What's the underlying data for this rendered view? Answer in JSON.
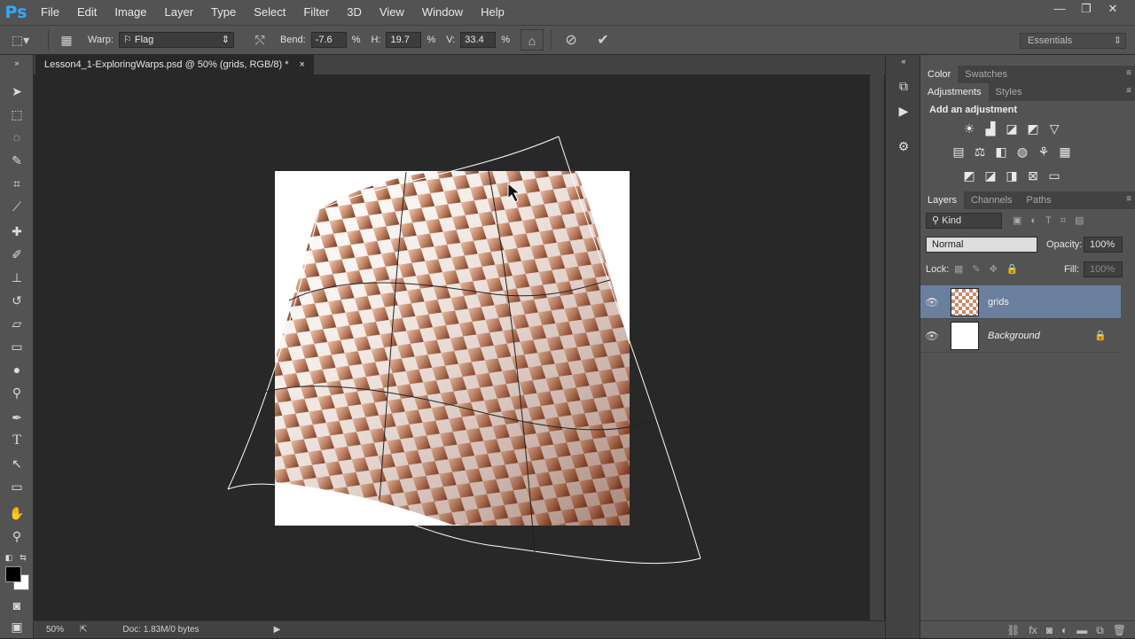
{
  "app": {
    "logo": "Ps",
    "menu": [
      "File",
      "Edit",
      "Image",
      "Layer",
      "Type",
      "Select",
      "Filter",
      "3D",
      "View",
      "Window",
      "Help"
    ],
    "window_controls": [
      "—",
      "❐",
      "✕"
    ]
  },
  "options": {
    "warp_label": "Warp:",
    "warp_style": "Flag",
    "bend_label": "Bend:",
    "bend_value": "-7.6",
    "h_label": "H:",
    "h_value": "19.7",
    "v_label": "V:",
    "v_value": "33.4",
    "percent": "%",
    "workspace": "Essentials"
  },
  "document": {
    "tab_title": "Lesson4_1-ExploringWarps.psd @ 50% (grids, RGB/8) *",
    "close": "×",
    "checker_colors": [
      "#f2c6ad",
      "#6e2a10"
    ]
  },
  "status": {
    "zoom": "50%",
    "doc": "Doc: 1.83M/0 bytes"
  },
  "panels": {
    "color_tabs": [
      "Color",
      "Swatches"
    ],
    "adjust_tabs": [
      "Adjustments",
      "Styles"
    ],
    "adjust_title": "Add an adjustment",
    "layer_tabs": [
      "Layers",
      "Channels",
      "Paths"
    ],
    "kind_label": "Kind",
    "blend_mode": "Normal",
    "opacity_label": "Opacity:",
    "opacity_value": "100%",
    "lock_label": "Lock:",
    "fill_label": "Fill:",
    "fill_value": "100%",
    "layers": [
      {
        "name": "grids",
        "selected": true
      },
      {
        "name": "Background",
        "selected": false
      }
    ]
  }
}
